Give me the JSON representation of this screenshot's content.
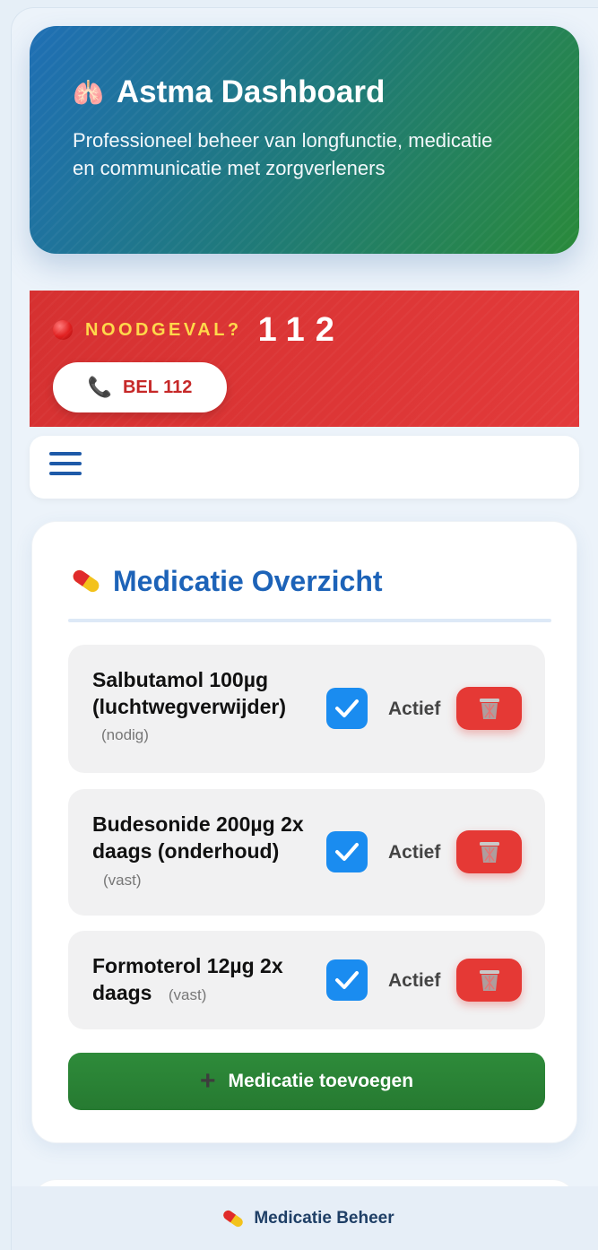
{
  "hero": {
    "icon": "lungs-icon",
    "title": "Astma Dashboard",
    "subtitle": "Professioneel beheer van longfunctie, medicatie en communicatie met zorgverleners"
  },
  "emergency": {
    "icon": "red-circle-icon",
    "label": "NOODGEVAL?",
    "number": "112",
    "call_button": "BEL 112",
    "call_icon": "phone-icon"
  },
  "nav": {
    "menu_icon": "hamburger-menu-icon"
  },
  "medication": {
    "title": "Medicatie Overzicht",
    "title_icon": "pill-icon",
    "items": [
      {
        "name": "Salbutamol 100µg (luchtwegverwijder)",
        "type": "(nodig)",
        "checked": true,
        "status": "Actief"
      },
      {
        "name": "Budesonide 200µg 2x daags (onderhoud)",
        "type": "(vast)",
        "checked": true,
        "status": "Actief"
      },
      {
        "name": "Formoterol 12µg 2x daags",
        "type": "(vast)",
        "checked": true,
        "status": "Actief"
      }
    ],
    "add_button": "Medicatie toevoegen"
  },
  "footer": {
    "label": "Medicatie Beheer",
    "icon": "pill-icon"
  },
  "colors": {
    "primary": "#1d63b8",
    "emergency": "#e23a3a",
    "warning_text": "#ffd84a",
    "success": "#2e8b3a",
    "delete": "#e53935",
    "checkbox": "#1a8cf0"
  }
}
